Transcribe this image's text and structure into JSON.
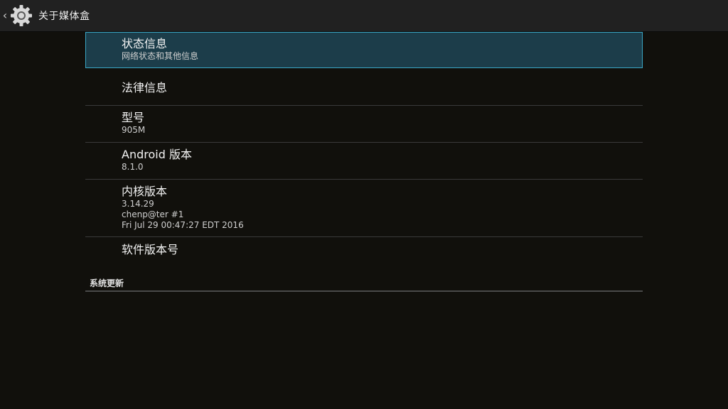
{
  "action_bar": {
    "title": "关于媒体盒",
    "back_glyph": "‹",
    "icon": "gear-icon"
  },
  "items": [
    {
      "title": "状态信息",
      "summary": "网络状态和其他信息"
    },
    {
      "title": "法律信息"
    },
    {
      "title": "型号",
      "summary": "905M"
    },
    {
      "title": "Android 版本",
      "summary": "8.1.0"
    },
    {
      "title": "内核版本",
      "summary_lines": [
        "3.14.29",
        "chenp@ter #1",
        "Fri Jul 29 00:47:27 EDT 2016"
      ]
    },
    {
      "title": "软件版本号"
    }
  ],
  "section_header": "系统更新",
  "colors": {
    "background": "#11100c",
    "action_bar": "#212121",
    "selected_bg": "#1c3d4a",
    "selected_border": "#3aa6c4",
    "divider": "#3a3a3a"
  }
}
